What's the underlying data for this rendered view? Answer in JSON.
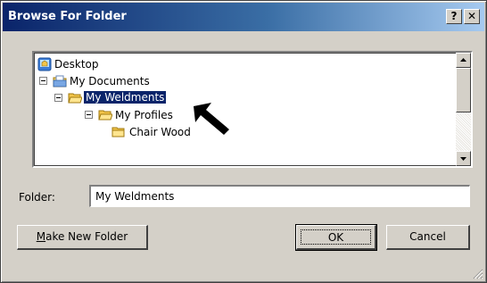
{
  "window": {
    "title": "Browse For Folder",
    "help_glyph": "?",
    "close_glyph": "✕"
  },
  "tree": {
    "items": [
      {
        "label": "Desktop",
        "icon": "desktop-icon"
      },
      {
        "label": "My Documents",
        "icon": "my-documents-icon"
      },
      {
        "label": "My Weldments",
        "icon": "folder-open-icon",
        "selected": true
      },
      {
        "label": "My Profiles",
        "icon": "folder-icon"
      },
      {
        "label": "Chair Wood",
        "icon": "folder-icon"
      }
    ]
  },
  "folder": {
    "label": "Folder:",
    "value": "My Weldments"
  },
  "buttons": {
    "make_new_folder_underline": "M",
    "make_new_folder_rest": "ake New Folder",
    "ok": "OK",
    "cancel": "Cancel"
  },
  "colors": {
    "dialog_bg": "#d4d0c8",
    "title_start": "#0a246a",
    "title_end": "#a6caf0",
    "selection": "#0a246a"
  }
}
